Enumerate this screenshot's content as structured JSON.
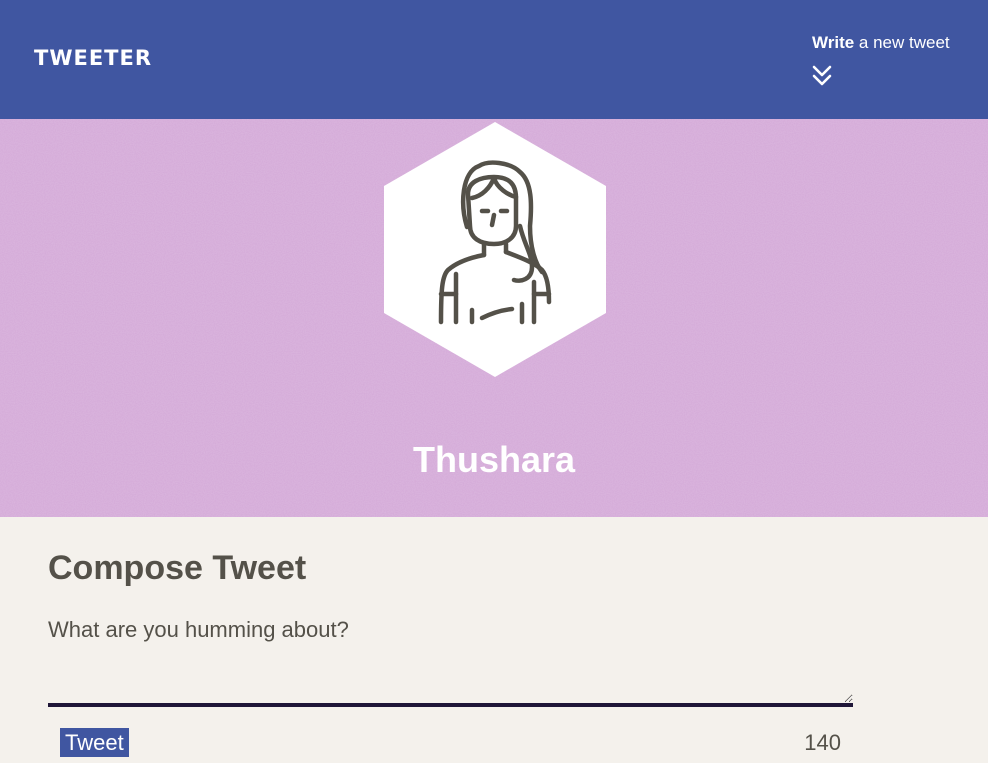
{
  "app": {
    "brand": "TWEETER",
    "nav": {
      "compose_strong": "Write",
      "compose_rest": " a new tweet",
      "arrow_icon": "double-chevron-down-icon"
    }
  },
  "profile": {
    "username": "Thushara",
    "avatar_icon": "woman-avatar-icon",
    "background_color": "#d3a8d7"
  },
  "compose": {
    "title": "Compose Tweet",
    "placeholder": "What are you humming about?",
    "value": "",
    "button_label": "Tweet",
    "char_counter": "140"
  },
  "colors": {
    "navbar": "#4056a1",
    "page_background": "#f4f1ec",
    "text": "#545149",
    "textarea_border": "#1f1638",
    "button": "#4056a1"
  }
}
